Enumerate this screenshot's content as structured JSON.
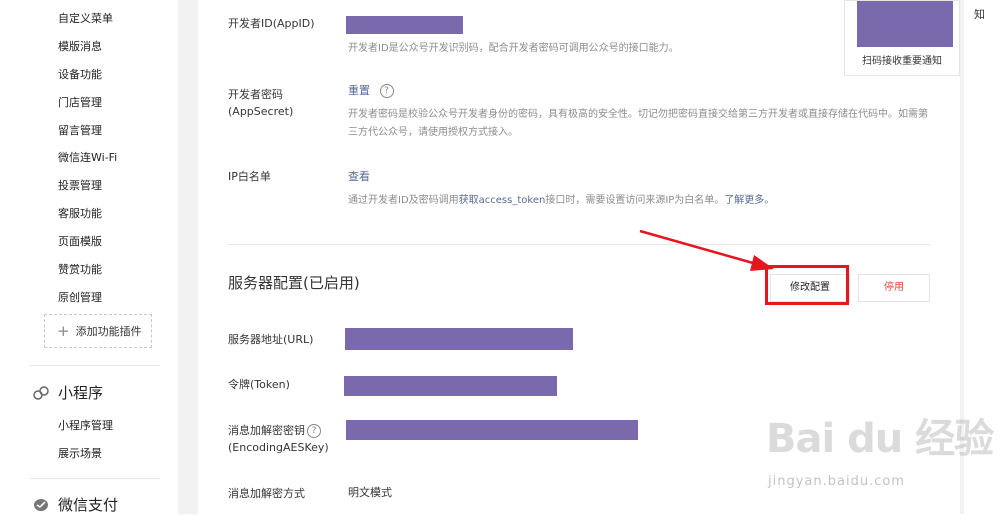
{
  "sidebar": {
    "items": [
      "自定义菜单",
      "模版消息",
      "设备功能",
      "门店管理",
      "留言管理",
      "微信连Wi-Fi",
      "投票管理",
      "客服功能",
      "页面模版",
      "赞赏功能",
      "原创管理"
    ],
    "add_plugin": "添加功能插件",
    "miniprogram": {
      "title": "小程序",
      "items": [
        "小程序管理",
        "展示场景"
      ]
    },
    "wechatpay": {
      "title": "微信支付"
    }
  },
  "dev": {
    "appid_label": "开发者ID(AppID)",
    "appid_desc": "开发者ID是公众号开发识别码，配合开发者密码可调用公众号的接口能力。",
    "secret_label_1": "开发者密码",
    "secret_label_2": "(AppSecret)",
    "secret_reset": "重置",
    "secret_desc": "开发者密码是校验公众号开发者身份的密码，具有极高的安全性。切记勿把密码直接交给第三方开发者或直接存储在代码中。如需第三方代公众号，请使用授权方式接入。",
    "ip_label": "IP白名单",
    "ip_view": "查看",
    "ip_desc_1": "通过开发者ID及密码调用",
    "ip_desc_link1": "获取access_token",
    "ip_desc_2": "接口时，需要设置访问来源IP为白名单。",
    "ip_desc_link2": "了解更多。"
  },
  "server": {
    "title": "服务器配置(已启用)",
    "modify_button": "修改配置",
    "stop_button": "停用",
    "url_label": "服务器地址(URL)",
    "token_label": "令牌(Token)",
    "aes_label_1": "消息加解密密钥",
    "aes_label_2": "(EncodingAESKey)",
    "mode_label": "消息加解密方式",
    "mode_value": "明文模式"
  },
  "qr": {
    "caption": "扫码接收重要通知"
  },
  "right_tab": "知",
  "watermark": {
    "brand": "Bai du 经验",
    "url": "jingyan.baidu.com"
  },
  "colors": {
    "redaction": "#7a6aad",
    "highlight": "#e4161f",
    "link": "#576b95",
    "danger": "#e64340"
  }
}
